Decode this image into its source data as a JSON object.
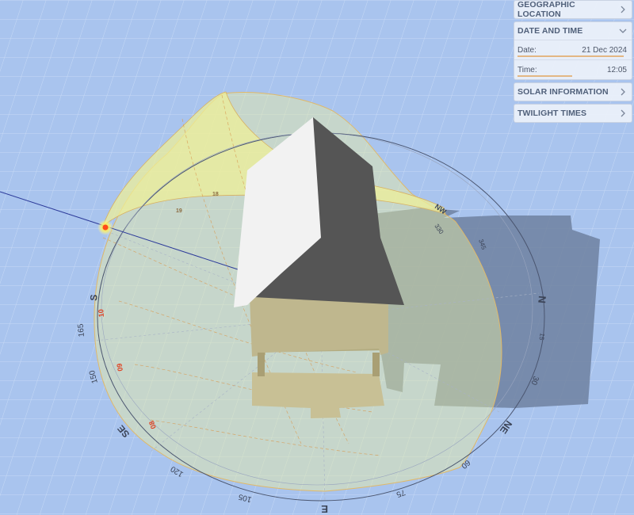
{
  "panel": {
    "sections": [
      {
        "id": "geo",
        "title": "GEOGRAPHIC LOCATION",
        "expanded": false
      },
      {
        "id": "date",
        "title": "DATE AND TIME",
        "expanded": true,
        "fields": [
          {
            "label": "Date:",
            "value": "21 Dec 2024",
            "progress": 0.97
          },
          {
            "label": "Time:",
            "value": "12:05",
            "progress": 0.5
          }
        ]
      },
      {
        "id": "solar",
        "title": "SOLAR INFORMATION",
        "expanded": false
      },
      {
        "id": "twilight",
        "title": "TWILIGHT TIMES",
        "expanded": false
      }
    ]
  },
  "compass": {
    "labels": [
      "N",
      "15",
      "30",
      "NE",
      "60",
      "75",
      "E",
      "105",
      "120",
      "SE",
      "150",
      "165",
      "S",
      "NW",
      "345",
      "330",
      "NW"
    ],
    "cardinal": {
      "north": "N",
      "east": "E",
      "south": "S",
      "northeast": "NE",
      "southeast": "SE",
      "northwest": "NW"
    },
    "degrees": [
      "15",
      "30",
      "60",
      "75",
      "105",
      "120",
      "150",
      "165",
      "345",
      "330"
    ]
  },
  "sunpath": {
    "hour_labels": [
      "08",
      "09",
      "10",
      "18",
      "19"
    ]
  },
  "colors": {
    "background": "#a9c4ee",
    "grid": "#c6d8f4",
    "sunpath_fill": "#e9efa0",
    "sun": "#ff4a1a",
    "shadow": "#6d7f9c",
    "roof_light": "#f1f1f1",
    "roof_dark": "#555555",
    "wall": "#bdb58a"
  },
  "icons": {
    "collapsed": "chevron-right-icon",
    "expanded": "chevron-down-icon"
  }
}
